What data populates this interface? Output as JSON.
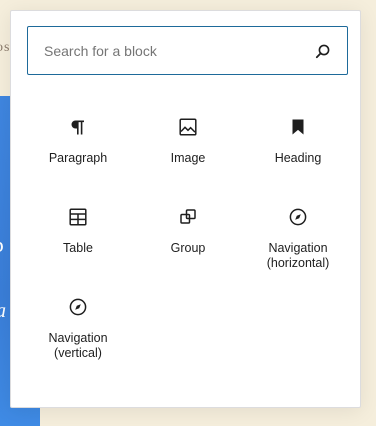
{
  "background": {
    "partial_text": "os",
    "accent_color": "#3f86e0"
  },
  "inserter": {
    "search": {
      "placeholder": "Search for a block",
      "value": "",
      "icon": "search-icon"
    },
    "blocks": [
      {
        "label": "Paragraph",
        "icon": "paragraph-icon"
      },
      {
        "label": "Image",
        "icon": "image-icon"
      },
      {
        "label": "Heading",
        "icon": "heading-icon"
      },
      {
        "label": "Table",
        "icon": "table-icon"
      },
      {
        "label": "Group",
        "icon": "group-icon"
      },
      {
        "label": "Navigation (horizontal)",
        "icon": "compass-icon"
      },
      {
        "label": "Navigation (vertical)",
        "icon": "compass-icon"
      }
    ]
  },
  "colors": {
    "search_border": "#1e6a9a",
    "text": "#1e1e1e",
    "placeholder": "#757575",
    "page_background": "#f5eedc"
  }
}
